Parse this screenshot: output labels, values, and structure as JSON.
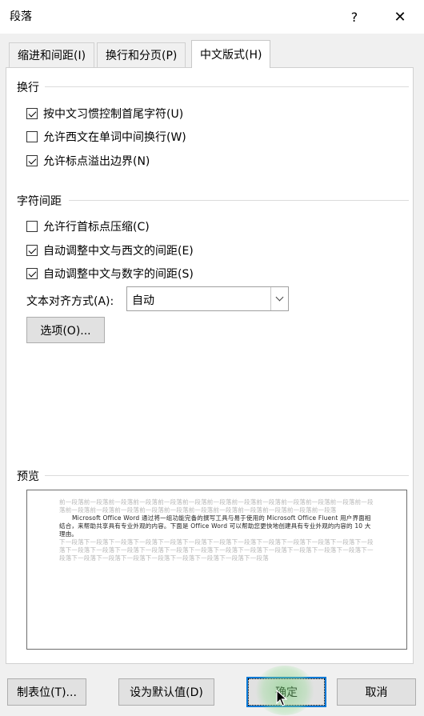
{
  "window": {
    "title": "段落",
    "help_glyph": "?",
    "close_glyph": "✕"
  },
  "tabs": [
    {
      "label": "缩进和间距(I)",
      "active": false
    },
    {
      "label": "换行和分页(P)",
      "active": false
    },
    {
      "label": "中文版式(H)",
      "active": true
    }
  ],
  "line_break": {
    "heading": "换行",
    "options": [
      {
        "label": "按中文习惯控制首尾字符(U)",
        "checked": true
      },
      {
        "label": "允许西文在单词中间换行(W)",
        "checked": false
      },
      {
        "label": "允许标点溢出边界(N)",
        "checked": true
      }
    ]
  },
  "char_spacing": {
    "heading": "字符间距",
    "options": [
      {
        "label": "允许行首标点压缩(C)",
        "checked": false
      },
      {
        "label": "自动调整中文与西文的间距(E)",
        "checked": true
      },
      {
        "label": "自动调整中文与数字的间距(S)",
        "checked": true
      }
    ]
  },
  "text_alignment": {
    "label": "文本对齐方式(A):",
    "value": "自动"
  },
  "options_button": "选项(O)...",
  "preview": {
    "heading": "预览",
    "prev_text": "前一段落前一段落前一段落前一段落前一段落前一段落前一段落前一段落前一段落前一段落前一段落前一段落前一段落前一段落前一段落前一段落前一段落前一段落前一段落前一段落前一段落前一段落前一段落前一段落",
    "main_text": "Microsoft Office Word 通过将一组功能完备的撰写工具与易于使用的 Microsoft Office Fluent 用户界面相结合，来帮助共享具有专业外观的内容。下面是 Office Word 可以帮助您更快地创建具有专业外观的内容的 10 大理由。",
    "next_text": "下一段落下一段落下一段落下一段落下一段落下一段落下一段落下一段落下一段落下一段落下一段落下一段落下一段落下一段落下一段落下一段落下一段落下一段落下一段落下一段落下一段落下一段落下一段落下一段落下一段落下一段落下一段落下一段落下一段落下一段落下一段落下一段落下一段落下一段落"
  },
  "buttons": {
    "tabs": "制表位(T)...",
    "set_default": "设为默认值(D)",
    "ok": "确定",
    "cancel": "取消"
  },
  "colors": {
    "accent": "#0078d7",
    "click_highlight": "#8fd68f"
  }
}
